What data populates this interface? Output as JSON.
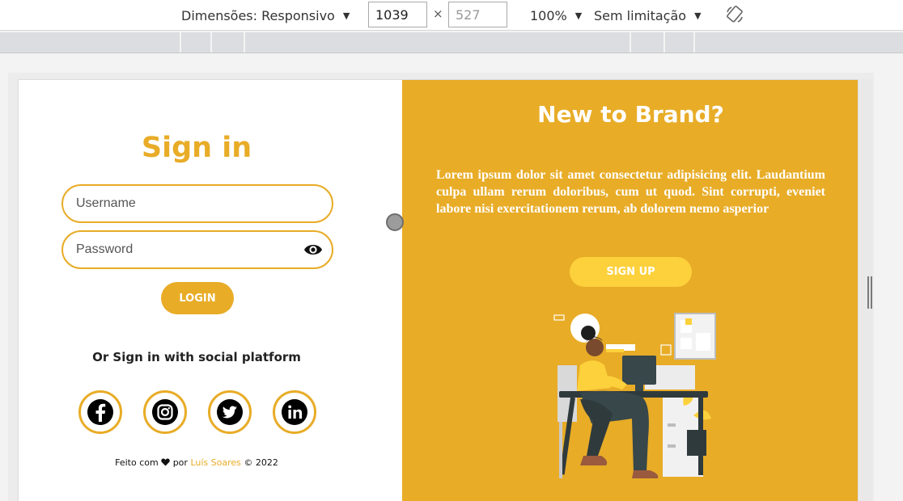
{
  "devtools": {
    "dimensions_label": "Dimensões: Responsivo",
    "width_value": "1039",
    "height_value": "527",
    "times_symbol": "×",
    "zoom": "100%",
    "throttle": "Sem limitação",
    "caret": "▼"
  },
  "signin": {
    "title": "Sign in",
    "username_placeholder": "Username",
    "password_placeholder": "Password",
    "login_label": "LOGIN",
    "social_text": "Or Sign in with social platform",
    "socials": [
      "facebook",
      "instagram",
      "twitter",
      "linkedin"
    ],
    "footer_prefix": "Feito com",
    "footer_middle": "por",
    "footer_author": "Luís Soares",
    "footer_suffix": "© 2022"
  },
  "signup": {
    "title": "New to Brand?",
    "text": "Lorem ipsum dolor sit amet consectetur adipisicing elit. Laudantium culpa ullam rerum doloribus, cum ut quod. Sint corrupti, eveniet labore nisi exercitationem rerum, ab dolorem nemo asperior",
    "button_label": "SIGN UP"
  },
  "colors": {
    "brand": "#e8ac27",
    "signup_button": "#fdd13c",
    "white": "#ffffff"
  }
}
